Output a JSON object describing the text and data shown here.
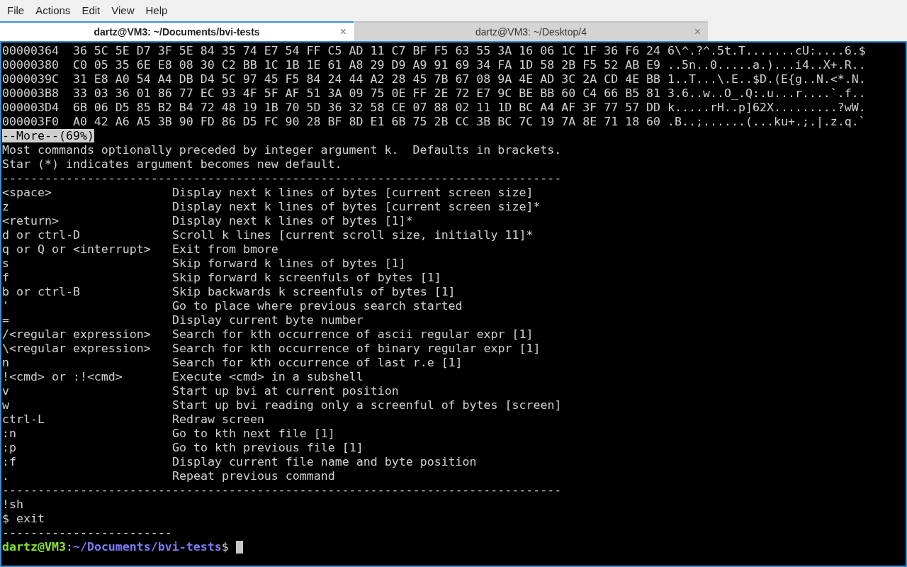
{
  "menu": [
    "File",
    "Actions",
    "Edit",
    "View",
    "Help"
  ],
  "tabs": [
    {
      "title": "dartz@VM3: ~/Documents/bvi-tests",
      "selected": true,
      "close": "×"
    },
    {
      "title": "dartz@VM3: ~/Desktop/4",
      "selected": false,
      "close": "×"
    }
  ],
  "terminal": [
    {
      "kind": "text",
      "text": "00000364  36 5C 5E D7 3F 5E 84 35 74 E7 54 FF C5 AD 11 C7 BF F5 63 55 3A 16 06 1C 1F 36 F6 24 6\\^.?^.5t.T.......cU:....6.$"
    },
    {
      "kind": "text",
      "text": "00000380  C0 05 35 6E E8 08 30 C2 BB 1C 1B 1E 61 A8 29 D9 A9 91 69 34 FA 1D 58 2B F5 52 AB E9 ..5n..0.....a.)...i4..X+.R.."
    },
    {
      "kind": "text",
      "text": "0000039C  31 E8 A0 54 A4 DB D4 5C 97 45 F5 84 24 44 A2 28 45 7B 67 08 9A 4E AD 3C 2A CD 4E BB 1..T...\\.E..$D.(E{g..N.<*.N."
    },
    {
      "kind": "text",
      "text": "000003B8  33 03 36 01 86 77 EC 93 4F 5F AF 51 3A 09 75 0E FF 2E 72 E7 9C BE BB 60 C4 66 B5 81 3.6..w..O_.Q:.u...r....`.f.."
    },
    {
      "kind": "text",
      "text": "000003D4  6B 06 D5 85 B2 B4 72 48 19 1B 70 5D 36 32 58 CE 07 88 02 11 1D BC A4 AF 3F 77 57 DD k.....rH..p]62X.........?wW."
    },
    {
      "kind": "text",
      "text": "000003F0  A0 42 A6 A5 3B 90 FD 86 D5 FC 90 28 BF 8D E1 6B 75 2B CC 3B BC 7C 19 7A 8E 71 18 60 .B..;......(...ku+.;.|.z.q.`"
    },
    {
      "kind": "highlight",
      "text": "--More--(69%)"
    },
    {
      "kind": "text",
      "text": "Most commands optionally preceded by integer argument k.  Defaults in brackets."
    },
    {
      "kind": "text",
      "text": "Star (*) indicates argument becomes new default."
    },
    {
      "kind": "rule",
      "text": "-------------------------------------------------------------------------------"
    },
    {
      "kind": "help",
      "key": "<space>",
      "desc": "Display next k lines of bytes [current screen size]"
    },
    {
      "kind": "help",
      "key": "z",
      "desc": "Display next k lines of bytes [current screen size]*"
    },
    {
      "kind": "help",
      "key": "<return>",
      "desc": "Display next k lines of bytes [1]*"
    },
    {
      "kind": "help",
      "key": "d or ctrl-D",
      "desc": "Scroll k lines [current scroll size, initially 11]*"
    },
    {
      "kind": "help",
      "key": "q or Q or <interrupt>",
      "desc": "Exit from bmore"
    },
    {
      "kind": "help",
      "key": "s",
      "desc": "Skip forward k lines of bytes [1]"
    },
    {
      "kind": "help",
      "key": "f",
      "desc": "Skip forward k screenfuls of bytes [1]"
    },
    {
      "kind": "help",
      "key": "b or ctrl-B",
      "desc": "Skip backwards k screenfuls of bytes [1]"
    },
    {
      "kind": "help",
      "key": "'",
      "desc": "Go to place where previous search started"
    },
    {
      "kind": "help",
      "key": "=",
      "desc": "Display current byte number"
    },
    {
      "kind": "help",
      "key": "/<regular expression>",
      "desc": "Search for kth occurrence of ascii regular expr [1]"
    },
    {
      "kind": "help",
      "key": "\\<regular expression>",
      "desc": "Search for kth occurrence of binary regular expr [1]"
    },
    {
      "kind": "help",
      "key": "n",
      "desc": "Search for kth occurrence of last r.e [1]"
    },
    {
      "kind": "help",
      "key": "!<cmd> or :!<cmd>",
      "desc": "Execute <cmd> in a subshell"
    },
    {
      "kind": "help",
      "key": "v",
      "desc": "Start up bvi at current position"
    },
    {
      "kind": "help",
      "key": "w",
      "desc": "Start up bvi reading only a screenful of bytes [screen]"
    },
    {
      "kind": "help",
      "key": "ctrl-L",
      "desc": "Redraw screen"
    },
    {
      "kind": "help",
      "key": ":n",
      "desc": "Go to kth next file [1]"
    },
    {
      "kind": "help",
      "key": ":p",
      "desc": "Go to kth previous file [1]"
    },
    {
      "kind": "help",
      "key": ":f",
      "desc": "Display current file name and byte position"
    },
    {
      "kind": "help",
      "key": ".",
      "desc": "Repeat previous command"
    },
    {
      "kind": "rule",
      "text": "-------------------------------------------------------------------------------"
    },
    {
      "kind": "text",
      "text": "!sh"
    },
    {
      "kind": "text",
      "text": "$ exit"
    },
    {
      "kind": "rule",
      "text": "------------------------"
    },
    {
      "kind": "prompt",
      "user": "dartz@VM3",
      "sep": ":",
      "path": "~/Documents/bvi-tests",
      "symbol": "$"
    }
  ]
}
